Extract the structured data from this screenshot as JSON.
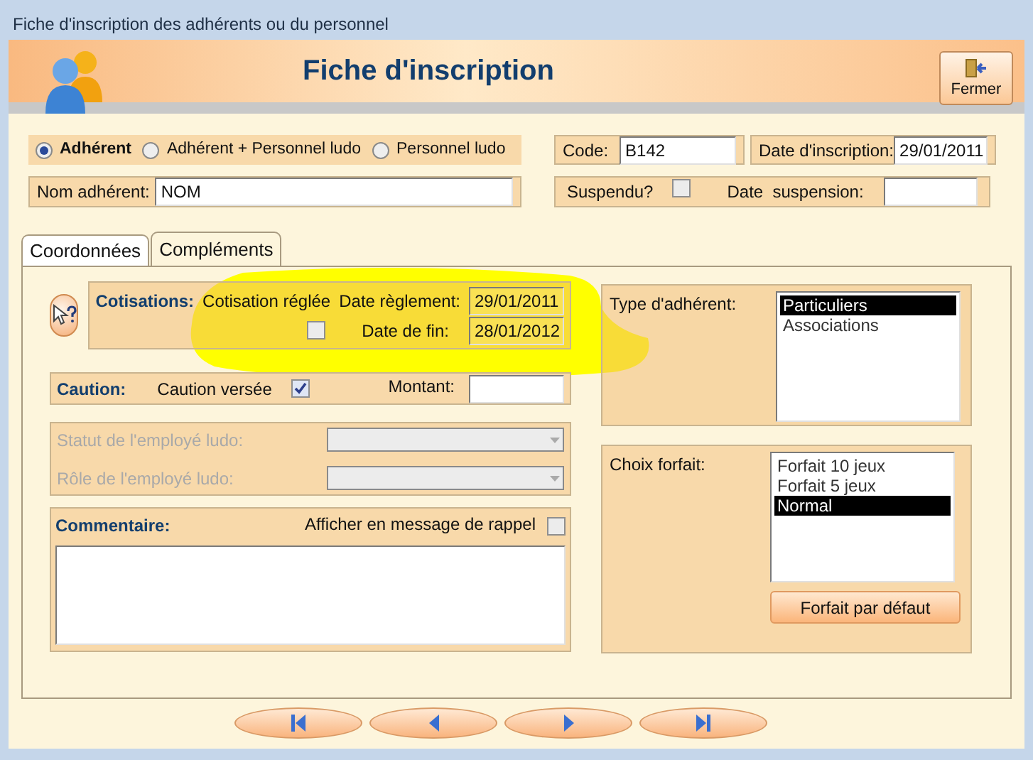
{
  "window": {
    "title": "Fiche d'inscription des adhérents ou du personnel"
  },
  "header": {
    "title": "Fiche d'inscription",
    "close_button": "Fermer"
  },
  "member_type": [
    {
      "label": "Adhérent",
      "selected": true
    },
    {
      "label": "Adhérent + Personnel ludo",
      "selected": false
    },
    {
      "label": "Personnel ludo",
      "selected": false
    }
  ],
  "name_field": {
    "label": "Nom adhérent:",
    "value": "NOM"
  },
  "code_field": {
    "label": "Code:",
    "value": "B142"
  },
  "registration_date": {
    "label": "Date d'inscription:",
    "value": "29/01/2011"
  },
  "suspended": {
    "label": "Suspendu?",
    "checked": false
  },
  "suspension_date": {
    "label": "Date  suspension:"
  },
  "tabs": [
    {
      "label": "Coordonnées",
      "selected": false
    },
    {
      "label": "Compléments",
      "selected": true
    }
  ],
  "cotisations": {
    "title": "Cotisations:",
    "paid_label": "Cotisation réglée",
    "paid": false,
    "payment_date_label": "Date règlement:",
    "payment_date": "29/01/2011",
    "end_date_label": "Date de fin:",
    "end_date": "28/01/2012"
  },
  "caution": {
    "title": "Caution:",
    "paid_label": "Caution versée",
    "paid": true,
    "amount_label": "Montant:"
  },
  "employee_fields": [
    {
      "label": "Statut de l'employé ludo:",
      "disabled": true
    },
    {
      "label": "Rôle de l'employé ludo:",
      "disabled": true
    }
  ],
  "comment": {
    "title": "Commentaire:",
    "reminder_label": "Afficher en message de rappel",
    "reminder": false
  },
  "member_kinds": {
    "label": "Type d'adhérent:",
    "items": [
      {
        "label": "Particuliers",
        "selected": true
      },
      {
        "label": "Associations",
        "selected": false
      }
    ]
  },
  "plans": {
    "label": "Choix forfait:",
    "items": [
      {
        "label": "Forfait 10 jeux",
        "selected": false
      },
      {
        "label": "Forfait 5 jeux",
        "selected": false
      },
      {
        "label": "Normal",
        "selected": true
      }
    ],
    "default_button": "Forfait par défaut"
  },
  "navigation": [
    {
      "kind": "first"
    },
    {
      "kind": "previous"
    },
    {
      "kind": "next"
    },
    {
      "kind": "last"
    }
  ]
}
